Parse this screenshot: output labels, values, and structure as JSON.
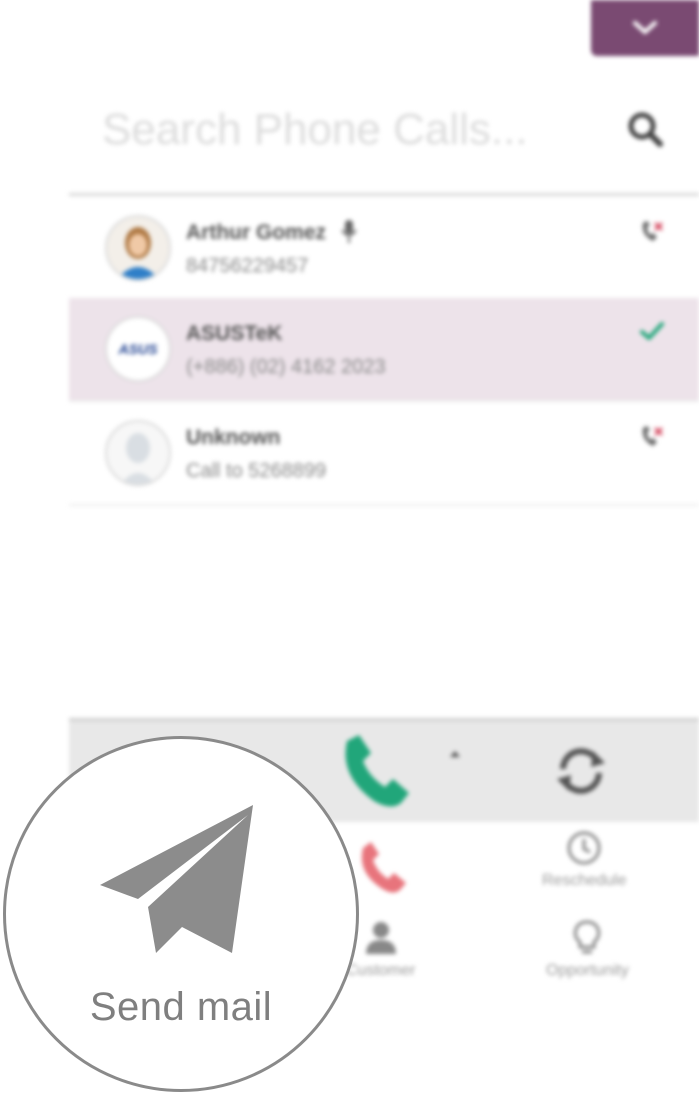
{
  "search": {
    "placeholder": "Search Phone Calls..."
  },
  "calls": [
    {
      "name": "Arthur Gomez",
      "number": "84756229457",
      "status": "missed-call",
      "has_mic": true
    },
    {
      "name": "ASUSTeK",
      "number": "(+886) (02) 4162 2023",
      "status": "done",
      "avatar_text": "ASUS"
    },
    {
      "name": "Unknown",
      "number": "Call to 5268899",
      "status": "missed-call"
    }
  ],
  "actions": {
    "reschedule": "Reschedule",
    "customer": "Customer",
    "opportunity": "Opportunity"
  },
  "magnifier": {
    "label": "Send mail",
    "icon": "paper-plane-icon"
  },
  "colors": {
    "brand": "#7a4a72",
    "call_green": "#21a67a",
    "hangup_red": "#e8747c",
    "selected_row": "#ede3ea"
  }
}
